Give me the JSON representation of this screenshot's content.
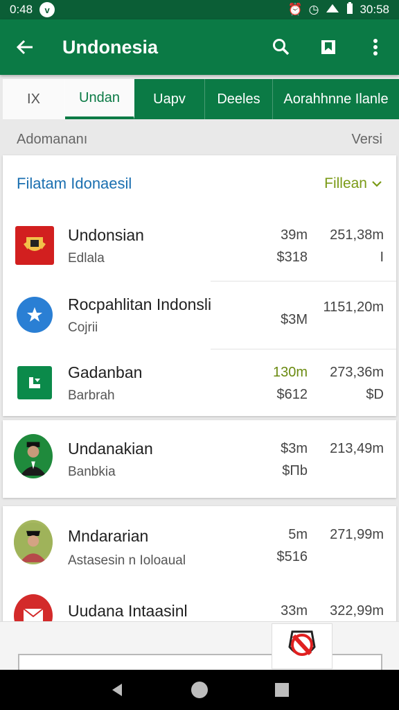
{
  "status_bar": {
    "time_left": "0:48",
    "notification_glyph": "v",
    "time_right": "30:58"
  },
  "app_bar": {
    "title": "Undonesia",
    "icons": [
      "back-arrow-icon",
      "search-icon",
      "bookmark-icon",
      "more-vert-icon"
    ]
  },
  "tabs": [
    {
      "label": "IX"
    },
    {
      "label": "Undan"
    },
    {
      "label": "Uapv"
    },
    {
      "label": "Deeles"
    },
    {
      "label": "Aorahhnne  Ilanle"
    }
  ],
  "subheader": {
    "left": "Adomananı",
    "right": "Versi"
  },
  "card": {
    "title": "Filatam Idonaesil",
    "filter_label": "Fillean"
  },
  "rows": [
    {
      "name": "Undonsian",
      "sub": "Edlala",
      "v1": "39m",
      "v2": "$318",
      "v3": "251,38m",
      "v4": "I"
    },
    {
      "name": "Rocpahlitan Indonsli",
      "sub": "Cojrii",
      "v1": "",
      "v2": "$3M",
      "v3": "1151,20m",
      "v4": ""
    },
    {
      "name": "Gadanban",
      "sub": "Barbrah",
      "v1": "130m",
      "v2": "$612",
      "v3": "273,36m",
      "v4": "$D"
    },
    {
      "name": "Undanakian",
      "sub": "Banbkia",
      "v1": "$3m",
      "v2": "$Πb",
      "v3": "213,49m",
      "v4": ""
    },
    {
      "name": "Mndararian",
      "sub": "Astasesin n Ioloaual",
      "v1": "5m",
      "v2": "$516",
      "v3": "271,99m",
      "v4": ""
    },
    {
      "name": "Uudana Intaasinl",
      "sub": "",
      "v1": "33m",
      "v2": "",
      "v3": "322,99m",
      "v4": ""
    }
  ],
  "colors": {
    "primary": "#0b7a45",
    "primary_dark": "#0b5e36",
    "link_blue": "#1a6fb0",
    "accent_green": "#7a9a16"
  }
}
